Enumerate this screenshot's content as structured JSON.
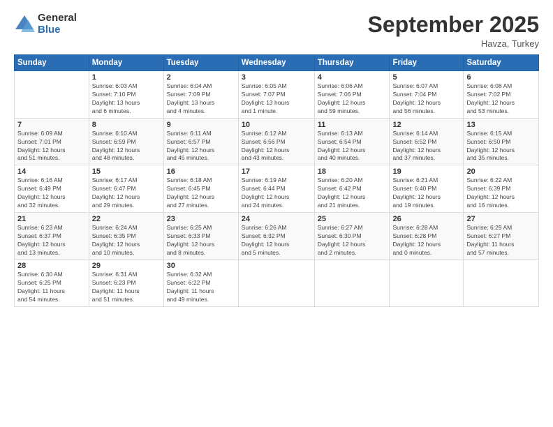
{
  "logo": {
    "general": "General",
    "blue": "Blue"
  },
  "header": {
    "month": "September 2025",
    "location": "Havza, Turkey"
  },
  "days_of_week": [
    "Sunday",
    "Monday",
    "Tuesday",
    "Wednesday",
    "Thursday",
    "Friday",
    "Saturday"
  ],
  "weeks": [
    [
      {
        "day": "",
        "info": ""
      },
      {
        "day": "1",
        "info": "Sunrise: 6:03 AM\nSunset: 7:10 PM\nDaylight: 13 hours\nand 6 minutes."
      },
      {
        "day": "2",
        "info": "Sunrise: 6:04 AM\nSunset: 7:09 PM\nDaylight: 13 hours\nand 4 minutes."
      },
      {
        "day": "3",
        "info": "Sunrise: 6:05 AM\nSunset: 7:07 PM\nDaylight: 13 hours\nand 1 minute."
      },
      {
        "day": "4",
        "info": "Sunrise: 6:06 AM\nSunset: 7:06 PM\nDaylight: 12 hours\nand 59 minutes."
      },
      {
        "day": "5",
        "info": "Sunrise: 6:07 AM\nSunset: 7:04 PM\nDaylight: 12 hours\nand 56 minutes."
      },
      {
        "day": "6",
        "info": "Sunrise: 6:08 AM\nSunset: 7:02 PM\nDaylight: 12 hours\nand 53 minutes."
      }
    ],
    [
      {
        "day": "7",
        "info": "Sunrise: 6:09 AM\nSunset: 7:01 PM\nDaylight: 12 hours\nand 51 minutes."
      },
      {
        "day": "8",
        "info": "Sunrise: 6:10 AM\nSunset: 6:59 PM\nDaylight: 12 hours\nand 48 minutes."
      },
      {
        "day": "9",
        "info": "Sunrise: 6:11 AM\nSunset: 6:57 PM\nDaylight: 12 hours\nand 45 minutes."
      },
      {
        "day": "10",
        "info": "Sunrise: 6:12 AM\nSunset: 6:56 PM\nDaylight: 12 hours\nand 43 minutes."
      },
      {
        "day": "11",
        "info": "Sunrise: 6:13 AM\nSunset: 6:54 PM\nDaylight: 12 hours\nand 40 minutes."
      },
      {
        "day": "12",
        "info": "Sunrise: 6:14 AM\nSunset: 6:52 PM\nDaylight: 12 hours\nand 37 minutes."
      },
      {
        "day": "13",
        "info": "Sunrise: 6:15 AM\nSunset: 6:50 PM\nDaylight: 12 hours\nand 35 minutes."
      }
    ],
    [
      {
        "day": "14",
        "info": "Sunrise: 6:16 AM\nSunset: 6:49 PM\nDaylight: 12 hours\nand 32 minutes."
      },
      {
        "day": "15",
        "info": "Sunrise: 6:17 AM\nSunset: 6:47 PM\nDaylight: 12 hours\nand 29 minutes."
      },
      {
        "day": "16",
        "info": "Sunrise: 6:18 AM\nSunset: 6:45 PM\nDaylight: 12 hours\nand 27 minutes."
      },
      {
        "day": "17",
        "info": "Sunrise: 6:19 AM\nSunset: 6:44 PM\nDaylight: 12 hours\nand 24 minutes."
      },
      {
        "day": "18",
        "info": "Sunrise: 6:20 AM\nSunset: 6:42 PM\nDaylight: 12 hours\nand 21 minutes."
      },
      {
        "day": "19",
        "info": "Sunrise: 6:21 AM\nSunset: 6:40 PM\nDaylight: 12 hours\nand 19 minutes."
      },
      {
        "day": "20",
        "info": "Sunrise: 6:22 AM\nSunset: 6:39 PM\nDaylight: 12 hours\nand 16 minutes."
      }
    ],
    [
      {
        "day": "21",
        "info": "Sunrise: 6:23 AM\nSunset: 6:37 PM\nDaylight: 12 hours\nand 13 minutes."
      },
      {
        "day": "22",
        "info": "Sunrise: 6:24 AM\nSunset: 6:35 PM\nDaylight: 12 hours\nand 10 minutes."
      },
      {
        "day": "23",
        "info": "Sunrise: 6:25 AM\nSunset: 6:33 PM\nDaylight: 12 hours\nand 8 minutes."
      },
      {
        "day": "24",
        "info": "Sunrise: 6:26 AM\nSunset: 6:32 PM\nDaylight: 12 hours\nand 5 minutes."
      },
      {
        "day": "25",
        "info": "Sunrise: 6:27 AM\nSunset: 6:30 PM\nDaylight: 12 hours\nand 2 minutes."
      },
      {
        "day": "26",
        "info": "Sunrise: 6:28 AM\nSunset: 6:28 PM\nDaylight: 12 hours\nand 0 minutes."
      },
      {
        "day": "27",
        "info": "Sunrise: 6:29 AM\nSunset: 6:27 PM\nDaylight: 11 hours\nand 57 minutes."
      }
    ],
    [
      {
        "day": "28",
        "info": "Sunrise: 6:30 AM\nSunset: 6:25 PM\nDaylight: 11 hours\nand 54 minutes."
      },
      {
        "day": "29",
        "info": "Sunrise: 6:31 AM\nSunset: 6:23 PM\nDaylight: 11 hours\nand 51 minutes."
      },
      {
        "day": "30",
        "info": "Sunrise: 6:32 AM\nSunset: 6:22 PM\nDaylight: 11 hours\nand 49 minutes."
      },
      {
        "day": "",
        "info": ""
      },
      {
        "day": "",
        "info": ""
      },
      {
        "day": "",
        "info": ""
      },
      {
        "day": "",
        "info": ""
      }
    ]
  ]
}
